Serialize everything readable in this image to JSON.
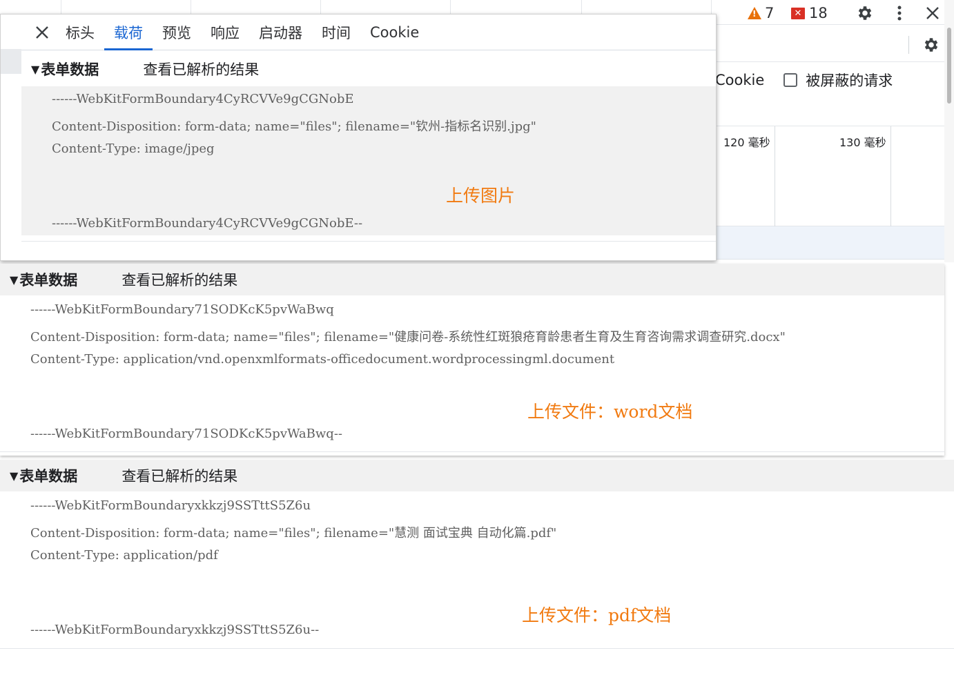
{
  "bg": {
    "warning_count": "7",
    "error_count": "18",
    "options": {
      "cookie_label": "Cookie",
      "blocked_label": "被屏蔽的请求"
    },
    "timeline": {
      "tick1": "120 毫秒",
      "tick2": "130 毫秒"
    }
  },
  "tabs": {
    "headers": "标头",
    "payload": "载荷",
    "preview": "预览",
    "response": "响应",
    "initiator": "启动器",
    "timing": "时间",
    "cookie": "Cookie"
  },
  "panel1": {
    "section_title": "表单数据",
    "view_parsed": "查看已解析的结果",
    "boundary": "------WebKitFormBoundary4CyRCVVe9gCGNobE",
    "disposition": "Content-Disposition: form-data; name=\"files\"; filename=\"钦州-指标名识别.jpg\"",
    "content_type": "Content-Type: image/jpeg",
    "boundary_end": "------WebKitFormBoundary4CyRCVVe9gCGNobE--",
    "annotation": "上传图片"
  },
  "panel2": {
    "section_title": "表单数据",
    "view_parsed": "查看已解析的结果",
    "boundary": "------WebKitFormBoundary71SODKcK5pvWaBwq",
    "disposition": "Content-Disposition: form-data; name=\"files\"; filename=\"健康问卷-系统性红斑狼疮育龄患者生育及生育咨询需求调查研究.docx\"",
    "content_type": "Content-Type: application/vnd.openxmlformats-officedocument.wordprocessingml.document",
    "boundary_end": "------WebKitFormBoundary71SODKcK5pvWaBwq--",
    "annotation": "上传文件：word文档"
  },
  "panel3": {
    "section_title": "表单数据",
    "view_parsed": "查看已解析的结果",
    "boundary": "------WebKitFormBoundaryxkkzj9SSTttS5Z6u",
    "disposition": "Content-Disposition: form-data; name=\"files\"; filename=\"慧测 面试宝典 自动化篇.pdf\"",
    "content_type": "Content-Type: application/pdf",
    "boundary_end": "------WebKitFormBoundaryxkkzj9SSTttS5Z6u--",
    "annotation": "上传文件：pdf文档"
  },
  "icons": [
    "warning-icon",
    "error-icon",
    "settings-gear-icon",
    "more-vert-icon",
    "close-icon",
    "collapse-triangle-icon"
  ],
  "colors": {
    "accent": "#1a66d2",
    "annotation": "#f17a10",
    "warning": "#e8710a",
    "error": "#d93025"
  }
}
